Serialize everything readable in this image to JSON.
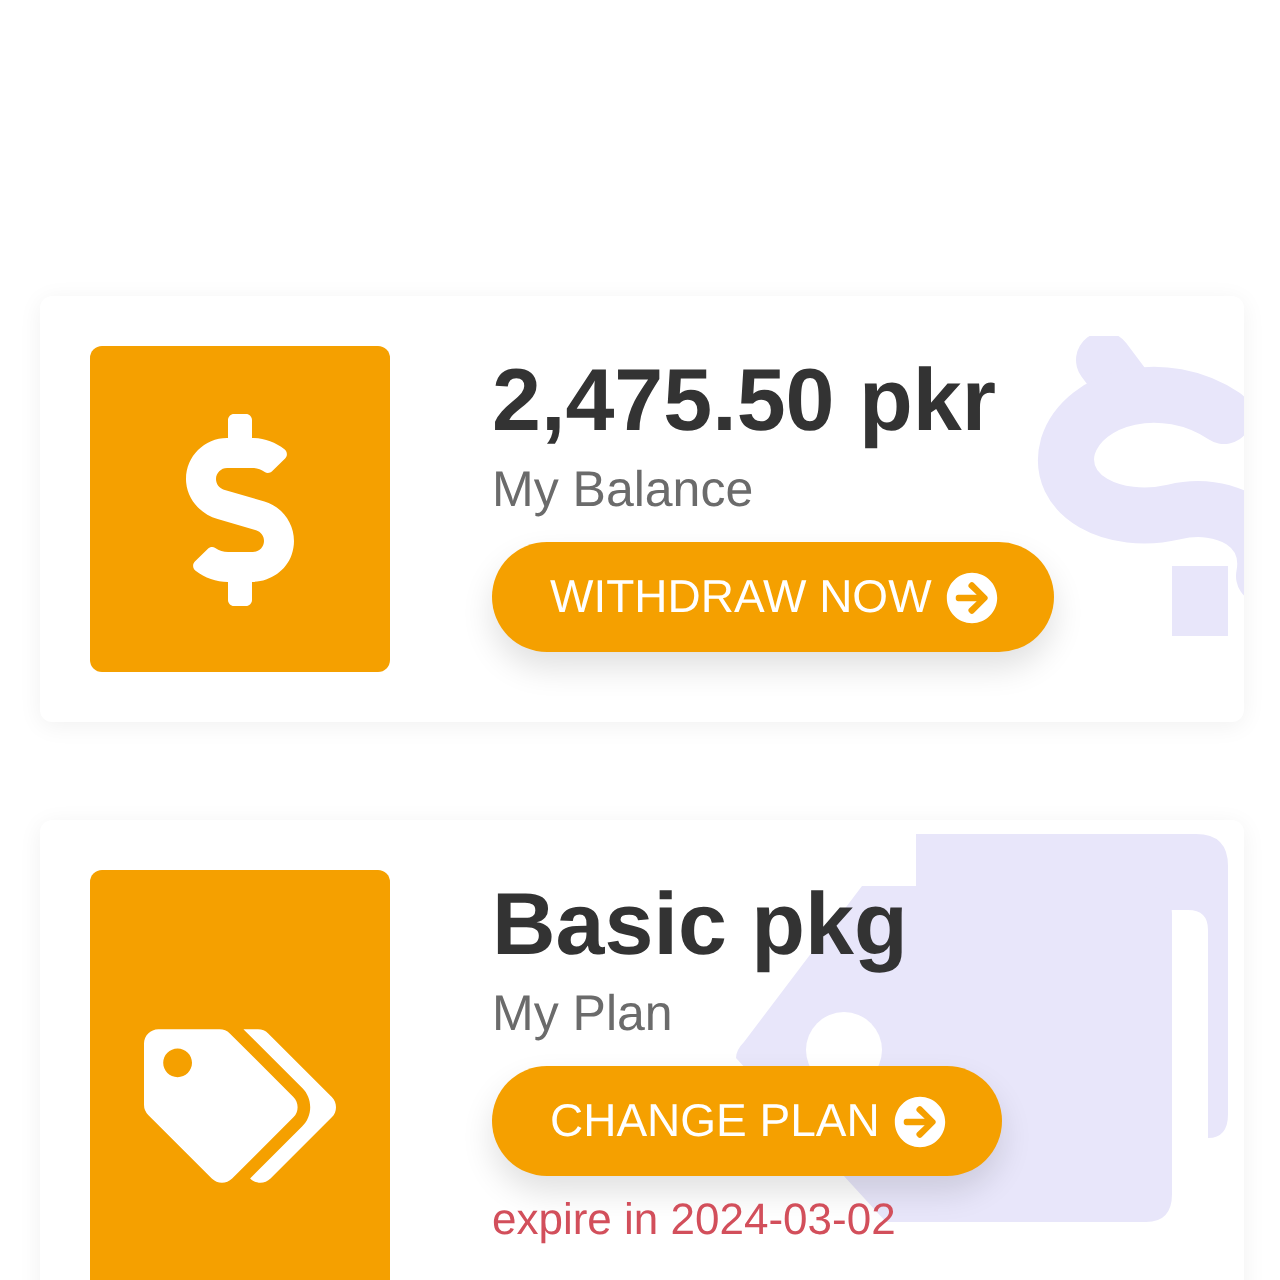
{
  "cards": [
    {
      "kind": "balance",
      "title": "2,475.50 pkr",
      "subtitle": "My Balance",
      "button": "WITHDRAW NOW"
    },
    {
      "kind": "plan",
      "title": "Basic pkg",
      "subtitle": "My Plan",
      "button": "CHANGE PLAN",
      "note": "expire in 2024-03-02"
    }
  ]
}
